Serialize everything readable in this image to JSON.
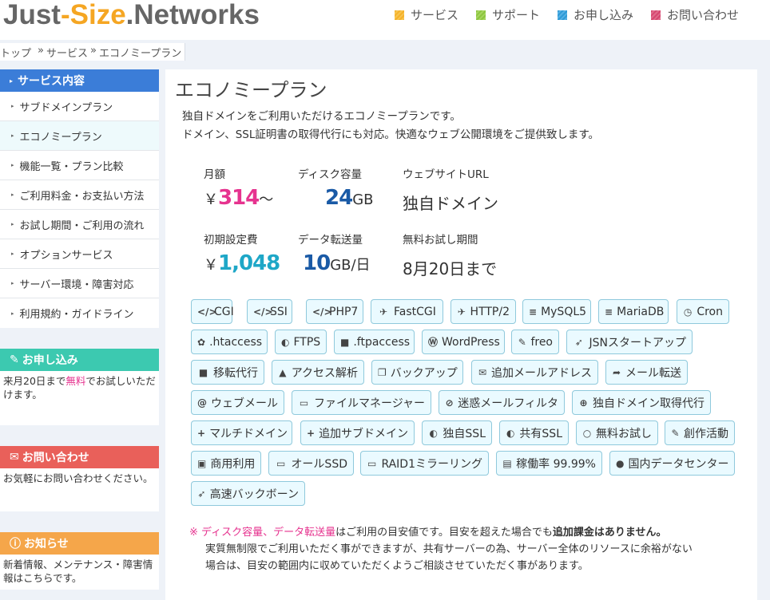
{
  "header": {
    "logo": {
      "part1": "Just",
      "part2": "-Size",
      "part3": ".Networks"
    },
    "nav": [
      {
        "label": "サービス",
        "color": "#f5b22a"
      },
      {
        "label": "サポート",
        "color": "#8cc63f"
      },
      {
        "label": "お申し込み",
        "color": "#2f9ad6"
      },
      {
        "label": "お問い合わせ",
        "color": "#d64770"
      }
    ]
  },
  "breadcrumb": {
    "home": "トップ",
    "sep1": "»",
    "services": "サービス",
    "sep2": "»",
    "current": "エコノミープラン"
  },
  "sidebar": {
    "heading": "サービス内容",
    "items": [
      "サブドメインプラン",
      "エコノミープラン",
      "機能一覧・プラン比較",
      "ご利用料金・お支払い方法",
      "お試し期間・ご利用の流れ",
      "オプションサービス",
      "サーバー環境・障害対応",
      "利用規約・ガイドライン"
    ],
    "apply": {
      "title": "お申し込み",
      "text_a": "来月20日まで",
      "text_free": "無料",
      "text_b": "でお試しいただけます。"
    },
    "contact": {
      "title": "お問い合わせ",
      "text": "お気軽にお問い合わせください。"
    },
    "news": {
      "title": "お知らせ",
      "text": "新着情報、メンテナンス・障害情報はこちらです。"
    }
  },
  "main": {
    "title": "エコノミープラン",
    "intro_line1": "独自ドメインをご利用いただけるエコノミープランです。",
    "intro_line2": "ドメイン、SSL証明書の取得代行にも対応。快適なウェブ公開環境をご提供致します。",
    "specs": {
      "monthly": {
        "label": "月額",
        "prefix": "￥",
        "value": "314",
        "suffix": "～"
      },
      "disk": {
        "label": "ディスク容量",
        "value": "24",
        "unit": "GB"
      },
      "url": {
        "label": "ウェブサイトURL",
        "value": "独自ドメイン"
      },
      "setup": {
        "label": "初期設定費",
        "prefix": "￥",
        "value": "1,048"
      },
      "transfer": {
        "label": "データ転送量",
        "value": "10",
        "unit": "GB/日"
      },
      "trial": {
        "label": "無料お試し期間",
        "value": "8月20日まで"
      }
    },
    "tags": [
      {
        "icon": "code-icon",
        "glyph": "</>",
        "label": "CGI"
      },
      {
        "icon": "code-icon",
        "glyph": "</>",
        "label": "SSI"
      },
      {
        "icon": "code-icon",
        "glyph": "</>",
        "label": "PHP7"
      },
      {
        "icon": "plane-icon",
        "glyph": "✈",
        "label": "FastCGI"
      },
      {
        "icon": "plane-icon",
        "glyph": "✈",
        "label": "HTTP/2"
      },
      {
        "icon": "database-icon",
        "glyph": "≡",
        "label": "MySQL5"
      },
      {
        "icon": "database-icon",
        "glyph": "≡",
        "label": "MariaDB"
      },
      {
        "icon": "clock-icon",
        "glyph": "◷",
        "label": "Cron"
      },
      {
        "icon": "gear-icon",
        "glyph": "✿",
        "label": ".htaccess"
      },
      {
        "icon": "shield-icon",
        "glyph": "◐",
        "label": "FTPS"
      },
      {
        "icon": "lock-icon",
        "glyph": "■",
        "label": ".ftpaccess"
      },
      {
        "icon": "wordpress-icon",
        "glyph": "Ⓦ",
        "label": "WordPress"
      },
      {
        "icon": "pencil-icon",
        "glyph": "✎",
        "label": "freo"
      },
      {
        "icon": "rocket-icon",
        "glyph": "➶",
        "label": "JSNスタートアップ"
      },
      {
        "icon": "truck-icon",
        "glyph": "■",
        "label": "移転代行"
      },
      {
        "icon": "chart-icon",
        "glyph": "▲",
        "label": "アクセス解析"
      },
      {
        "icon": "copy-icon",
        "glyph": "❐",
        "label": "バックアップ"
      },
      {
        "icon": "envelope-icon",
        "glyph": "✉",
        "label": "追加メールアドレス"
      },
      {
        "icon": "forward-icon",
        "glyph": "➦",
        "label": "メール転送"
      },
      {
        "icon": "at-icon",
        "glyph": "@",
        "label": "ウェブメール"
      },
      {
        "icon": "folder-icon",
        "glyph": "▭",
        "label": "ファイルマネージャー"
      },
      {
        "icon": "ban-icon",
        "glyph": "⊘",
        "label": "迷惑メールフィルタ"
      },
      {
        "icon": "globe-icon",
        "glyph": "⊕",
        "label": "独自ドメイン取得代行"
      },
      {
        "icon": "plus-icon",
        "glyph": "+",
        "label": "マルチドメイン"
      },
      {
        "icon": "plus-icon",
        "glyph": "+",
        "label": "追加サブドメイン"
      },
      {
        "icon": "shield-icon",
        "glyph": "◐",
        "label": "独自SSL"
      },
      {
        "icon": "shield-icon",
        "glyph": "◐",
        "label": "共有SSL"
      },
      {
        "icon": "comment-icon",
        "glyph": "○",
        "label": "無料お試し"
      },
      {
        "icon": "pencil-icon",
        "glyph": "✎",
        "label": "創作活動"
      },
      {
        "icon": "briefcase-icon",
        "glyph": "▣",
        "label": "商用利用"
      },
      {
        "icon": "hdd-icon",
        "glyph": "▭",
        "label": "オールSSD"
      },
      {
        "icon": "hdd-icon",
        "glyph": "▭",
        "label": "RAID1ミラーリング"
      },
      {
        "icon": "server-icon",
        "glyph": "▤",
        "label": "稼働率 99.99%"
      },
      {
        "icon": "map-marker-icon",
        "glyph": "●",
        "label": "国内データセンター"
      },
      {
        "icon": "rocket-icon",
        "glyph": "➶",
        "label": "高速バックボーン"
      }
    ],
    "note": {
      "mark": "※",
      "disk": "ディスク容量",
      "comma": "、",
      "transfer": "データ転送量",
      "text1": "はご利用の目安値です。目安を超えた場合でも",
      "bold": "追加課金はありません。",
      "line2": "実質無制限でご利用いただく事ができますが、共有サーバーの為、サーバー全体のリソースに余裕がない",
      "line3": "場合は、目安の範囲内に収めていただくようご相談させていただく事があります。"
    }
  }
}
